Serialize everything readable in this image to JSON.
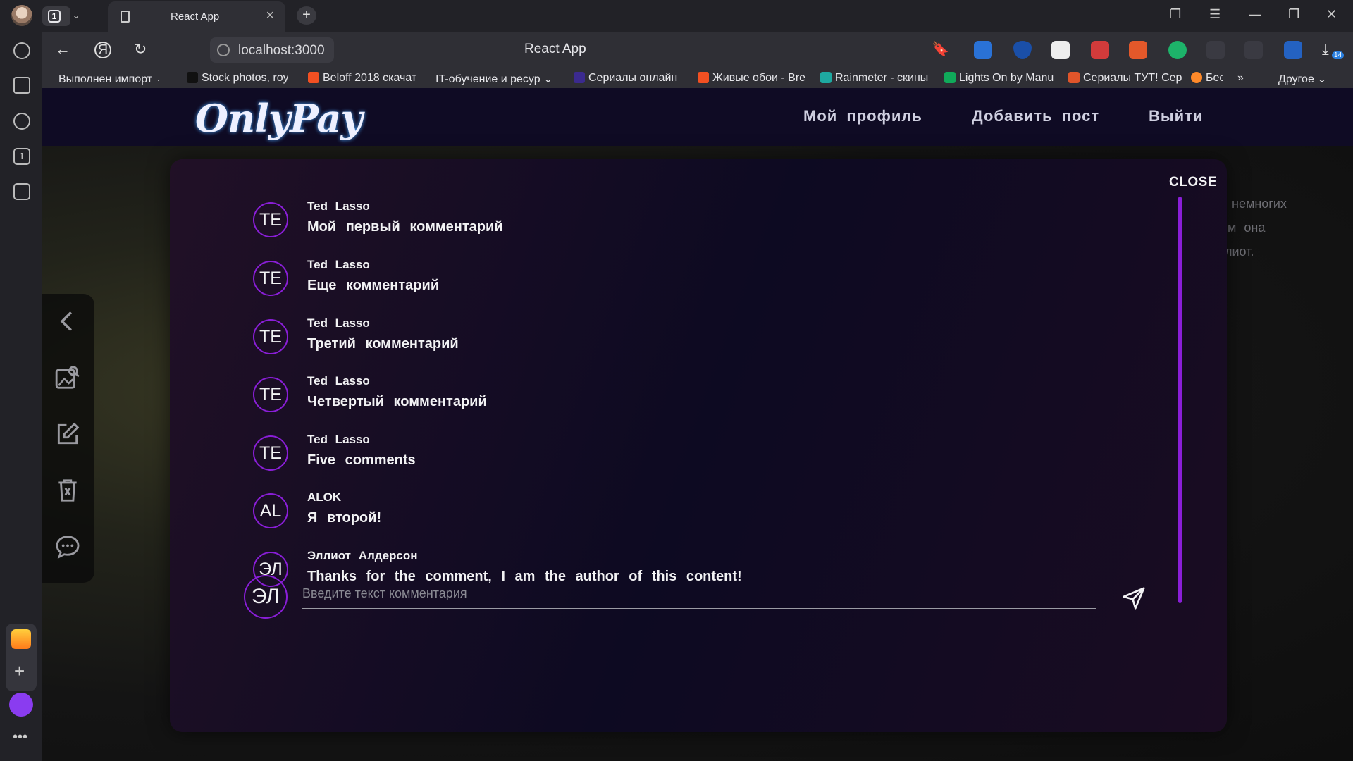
{
  "browser": {
    "tab_count": "1",
    "tab_title": "React App",
    "url": "localhost:3000",
    "page_title": "React App",
    "downloads_badge": "14",
    "bookmarks": [
      {
        "label": "Выполнен импорт",
        "color": "#2f2f35"
      },
      {
        "label": "Stock photos, roya",
        "color": "#111111"
      },
      {
        "label": "Beloff 2018 скачат",
        "color": "#f25022"
      },
      {
        "label": "IT-обучение и ресур",
        "color": "#2f2f35"
      },
      {
        "label": "Сериалы онлайн",
        "color": "#3b2a8f"
      },
      {
        "label": "Живые обои - Bre",
        "color": "#f25022"
      },
      {
        "label": "Rainmeter - скины",
        "color": "#1ea8a0"
      },
      {
        "label": "Lights On by Manu",
        "color": "#10aa5a"
      },
      {
        "label": "Сериалы ТУТ! Сер",
        "color": "#e0552a"
      },
      {
        "label": "Бес",
        "color": "#ff8a2a"
      }
    ],
    "bookmarks_other": "Другое"
  },
  "app": {
    "logo": "OnlyPay",
    "nav": {
      "profile": "Мой профиль",
      "add_post": "Добавить пост",
      "logout": "Выйти"
    },
    "bg_text": [
      "немногих",
      "м она",
      "лиот."
    ]
  },
  "modal": {
    "close_label": "CLOSE",
    "comments": [
      {
        "initials": "TE",
        "author": "Ted Lasso",
        "text": "Мой первый комментарий"
      },
      {
        "initials": "TE",
        "author": "Ted Lasso",
        "text": "Еще комментарий"
      },
      {
        "initials": "TE",
        "author": "Ted Lasso",
        "text": "Третий комментарий"
      },
      {
        "initials": "TE",
        "author": "Ted Lasso",
        "text": "Четвертый комментарий"
      },
      {
        "initials": "TE",
        "author": "Ted Lasso",
        "text": "Five comments"
      },
      {
        "initials": "AL",
        "author": "ALOK",
        "text": "Я второй!"
      },
      {
        "initials": "ЭЛ",
        "author": "Эллиот Алдерсон",
        "text": "Thanks for the comment, I am the author of this content!"
      }
    ],
    "input": {
      "user_initials": "ЭЛ",
      "placeholder": "Введите текст комментария",
      "value": ""
    }
  },
  "colors": {
    "accent": "#8a1ed8",
    "header_bg": "#0f0b24"
  }
}
